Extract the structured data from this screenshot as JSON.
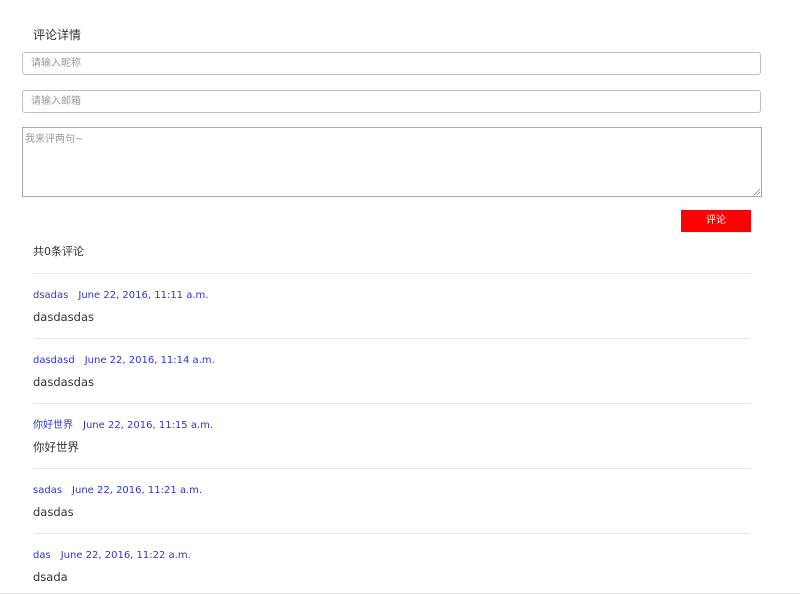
{
  "form": {
    "title": "评论详情",
    "nickname_placeholder": "请输入昵称",
    "email_placeholder": "请输入邮箱",
    "comment_placeholder": "我来评两句~",
    "submit_label": "评论"
  },
  "comments_count_text": "共0条评论",
  "comments": [
    {
      "author": "dsadas",
      "date": "June 22, 2016, 11:11 a.m.",
      "body": "dasdasdas"
    },
    {
      "author": "dasdasd",
      "date": "June 22, 2016, 11:14 a.m.",
      "body": "dasdasdas"
    },
    {
      "author": "你好世界",
      "date": "June 22, 2016, 11:15 a.m.",
      "body": "你好世界"
    },
    {
      "author": "sadas",
      "date": "June 22, 2016, 11:21 a.m.",
      "body": "dasdas"
    },
    {
      "author": "das",
      "date": "June 22, 2016, 11:22 a.m.",
      "body": "dsada"
    }
  ],
  "colors": {
    "accent": "#ff0000",
    "link": "#2a36d6"
  }
}
